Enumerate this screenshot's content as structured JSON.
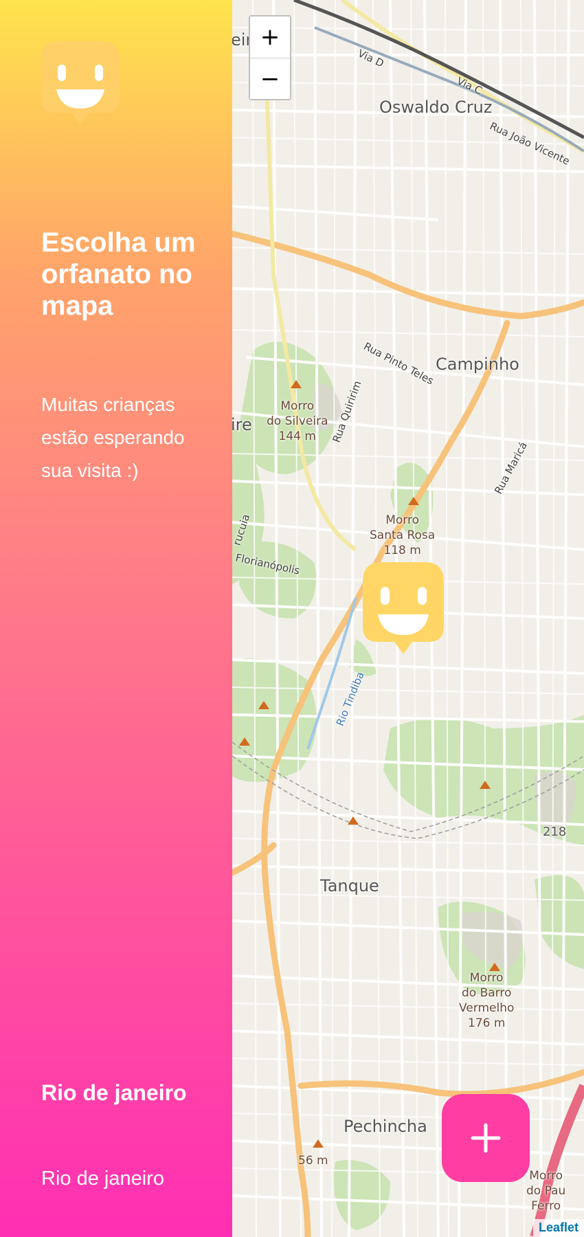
{
  "sidebar": {
    "logo_icon": "smiley-marker-icon",
    "headline": "Escolha um orfanato no mapa",
    "subtext": "Muitas crianças estão esperando sua visita :)",
    "city": "Rio de janeiro",
    "state": "Rio de janeiro"
  },
  "map": {
    "zoom_in_label": "+",
    "zoom_out_label": "−",
    "attribution": "Leaflet",
    "add_button_icon": "plus-icon",
    "marker_icon": "smiley-marker-icon",
    "labels": {
      "oswaldo_cruz": "Oswaldo Cruz",
      "campinho": "Campinho",
      "tanque": "Tanque",
      "pechincha": "Pechincha",
      "morro_silveira": "Morro\ndo Silveira\n144 m",
      "morro_santa_rosa": "Morro\nSanta Rosa\n118 m",
      "morro_barro": "Morro\ndo Barro\nVermelho\n176 m",
      "morro_pau_ferro": "Morro\ndo Pau\nFerro",
      "elev_56": "56 m",
      "elev_218": "218",
      "rua_joao_vicente": "Rua João Vicente",
      "rua_pinto_teles": "Rua Pinto Teles",
      "rua_quiririm": "Rua Quiririm",
      "rua_marica": "Rua Maricá",
      "florianopolis": "Florianópolis",
      "rio_tindiba": "Rio Tindiba",
      "via_c": "Via C",
      "via_d": "Via D",
      "madureira_partial": "eiro",
      "ire_partial": "ire",
      "urucuia_partial": "rucuia"
    }
  },
  "colors": {
    "gradient_top": "#ffe44d",
    "gradient_bottom": "#ff2fb3",
    "marker": "#ffd666",
    "fab": "#ff3da2",
    "road_major": "#f7c27a",
    "park": "#c8e2b0"
  }
}
